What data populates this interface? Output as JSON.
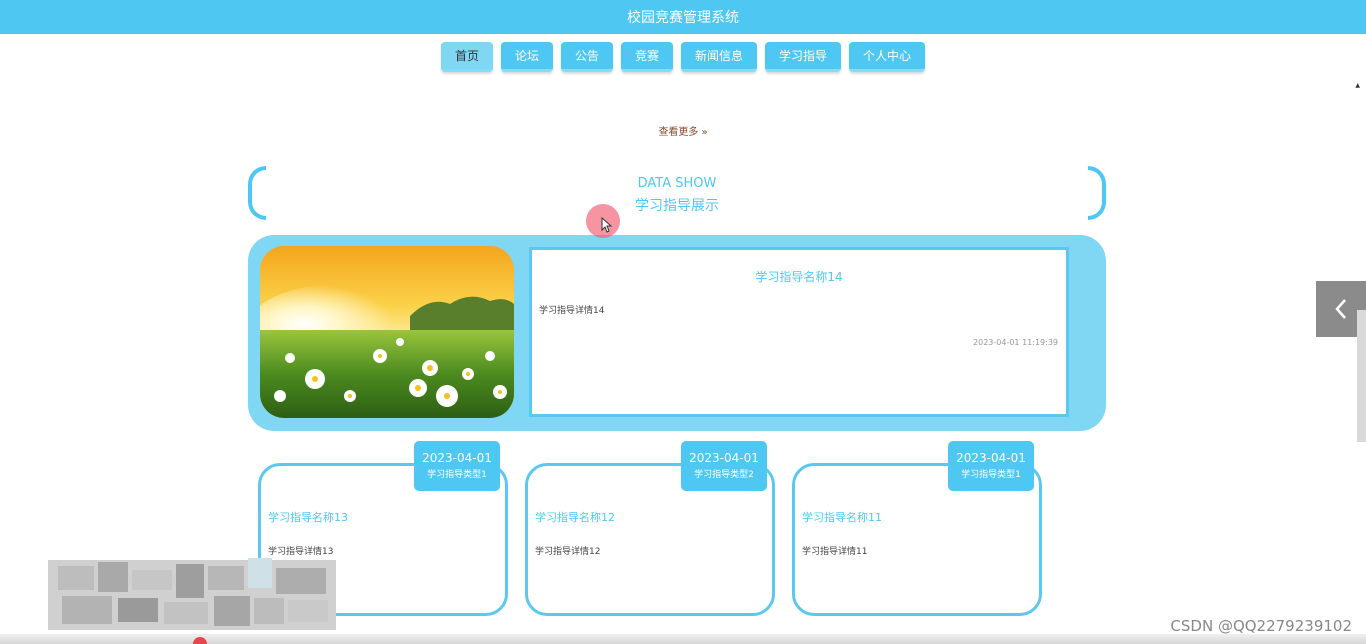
{
  "header": {
    "title": "校园竞赛管理系统"
  },
  "nav": {
    "items": [
      {
        "label": "首页",
        "active": true
      },
      {
        "label": "论坛"
      },
      {
        "label": "公告"
      },
      {
        "label": "竞赛"
      },
      {
        "label": "新闻信息"
      },
      {
        "label": "学习指导"
      },
      {
        "label": "个人中心"
      }
    ]
  },
  "more": {
    "label": "查看更多",
    "icon": "double-chevron-right-icon"
  },
  "section": {
    "title_en": "DATA SHOW",
    "title_cn": "学习指导展示"
  },
  "featured": {
    "name": "学习指导名称14",
    "detail": "学习指导详情14",
    "time": "2023-04-01 11:19:39"
  },
  "cards": [
    {
      "date": "2023-04-01",
      "type": "学习指导类型1",
      "name": "学习指导名称13",
      "detail": "学习指导详情13"
    },
    {
      "date": "2023-04-01",
      "type": "学习指导类型2",
      "name": "学习指导名称12",
      "detail": "学习指导详情12"
    },
    {
      "date": "2023-04-01",
      "type": "学习指导类型1",
      "name": "学习指导名称11",
      "detail": "学习指导详情11"
    }
  ],
  "side_button": {
    "icon": "chevron-left-icon"
  },
  "watermark": "CSDN @QQ2279239102",
  "colors": {
    "primary": "#4ec8f2",
    "panel": "#7fd7f4"
  }
}
